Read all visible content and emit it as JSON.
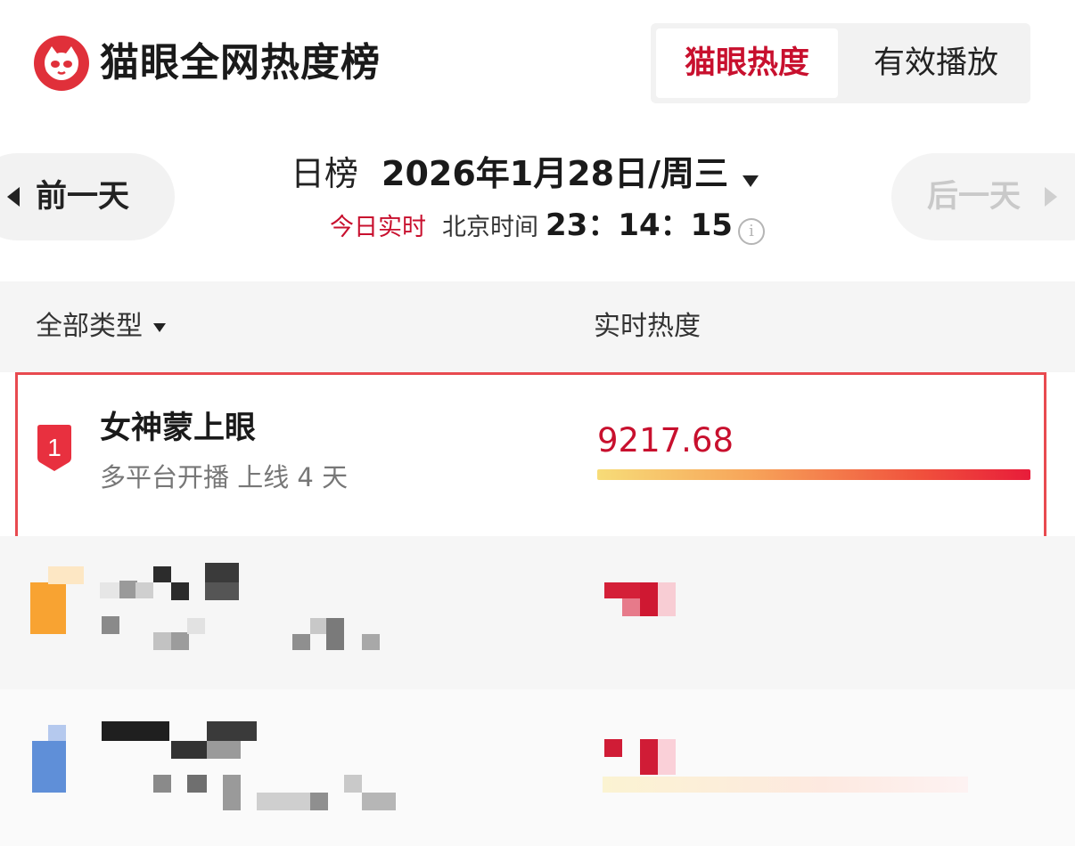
{
  "header": {
    "app_title": "猫眼全网热度榜",
    "logo_icon": "cat-face-logo-icon",
    "brand_color": "#e0303a",
    "tabs": [
      {
        "label": "猫眼热度",
        "active": true
      },
      {
        "label": "有效播放",
        "active": false
      }
    ]
  },
  "date_nav": {
    "prev_label": "前一天",
    "next_label": "后一天",
    "next_enabled": false,
    "board_type": "日榜",
    "date_text": "2026年1月28日/周三",
    "realtime_label": "今日实时",
    "timezone_label": "北京时间",
    "time": "23：14：15",
    "info_glyph": "i"
  },
  "list": {
    "filter_label": "全部类型",
    "heat_column_label": "实时热度",
    "rows": [
      {
        "rank": "1",
        "title": "女神蒙上眼",
        "subtitle": "多平台开播 上线 4 天",
        "heat": "9217.68",
        "heat_fraction": 1.0,
        "rank_color": "#e8303f",
        "highlighted": true
      },
      {
        "rank_color": "#f5a020",
        "pixelated": true
      },
      {
        "rank_color": "#5b8fd6",
        "pixelated": true
      }
    ]
  },
  "colors": {
    "accent": "#c8102e",
    "highlight_border": "#e84a50"
  }
}
